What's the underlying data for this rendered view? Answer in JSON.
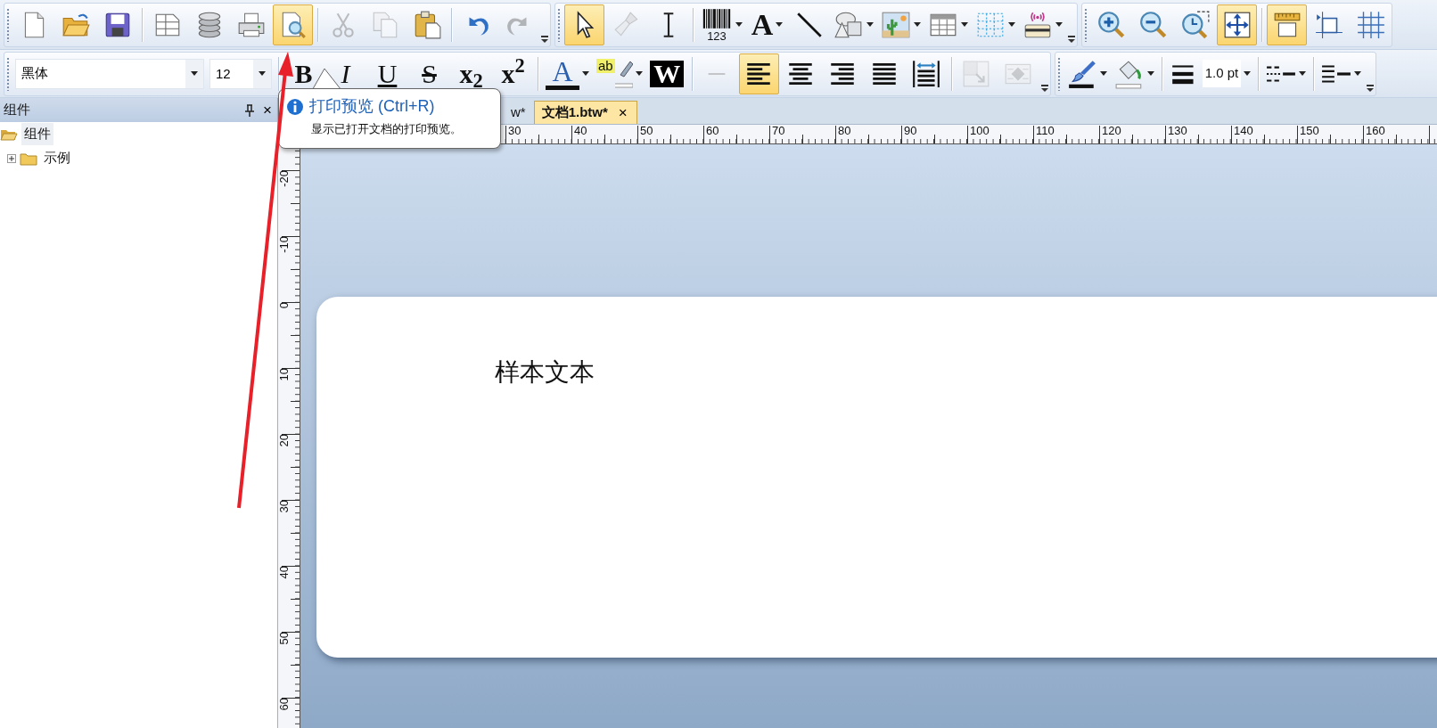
{
  "toolbars": [
    {
      "bands": [
        {
          "overflow": true,
          "items": [
            {
              "kind": "new",
              "selected": false,
              "disabled": false
            },
            {
              "kind": "open",
              "selected": false,
              "disabled": false
            },
            {
              "kind": "save",
              "selected": false,
              "disabled": false
            },
            {
              "kind": "separator"
            },
            {
              "kind": "layout",
              "selected": false,
              "disabled": false
            },
            {
              "kind": "database",
              "selected": false,
              "disabled": false
            },
            {
              "kind": "print",
              "selected": false,
              "disabled": false
            },
            {
              "kind": "preview",
              "selected": true,
              "disabled": false
            },
            {
              "kind": "separator"
            },
            {
              "kind": "cut",
              "selected": false,
              "disabled": true
            },
            {
              "kind": "copy",
              "selected": false,
              "disabled": true
            },
            {
              "kind": "paste",
              "selected": false,
              "disabled": false
            },
            {
              "kind": "separator"
            },
            {
              "kind": "undo",
              "selected": false,
              "disabled": false
            },
            {
              "kind": "redo",
              "selected": false,
              "disabled": true
            }
          ]
        },
        {
          "overflow": true,
          "items": [
            {
              "kind": "pointer",
              "selected": true,
              "disabled": false
            },
            {
              "kind": "brush",
              "selected": false,
              "disabled": true
            },
            {
              "kind": "ibeam",
              "selected": false,
              "disabled": false
            },
            {
              "kind": "separator"
            },
            {
              "kind": "barcode",
              "caption": "123",
              "selected": false,
              "disabled": false,
              "dropdown": true
            },
            {
              "kind": "text",
              "label": "A",
              "selected": false,
              "disabled": false,
              "dropdown": true
            },
            {
              "kind": "line",
              "selected": false,
              "disabled": false
            },
            {
              "kind": "shapes",
              "selected": false,
              "disabled": false,
              "dropdown": true
            },
            {
              "kind": "picture",
              "selected": false,
              "disabled": false,
              "dropdown": true
            },
            {
              "kind": "table",
              "selected": false,
              "disabled": false,
              "dropdown": true
            },
            {
              "kind": "grid",
              "selected": false,
              "disabled": false,
              "dropdown": true
            },
            {
              "kind": "rfid",
              "selected": false,
              "disabled": false,
              "dropdown": true
            }
          ]
        },
        {
          "overflow": false,
          "items": [
            {
              "kind": "zoomin",
              "selected": false,
              "disabled": false
            },
            {
              "kind": "zoomout",
              "selected": false,
              "disabled": false
            },
            {
              "kind": "zoompage",
              "selected": false,
              "disabled": false
            },
            {
              "kind": "fit",
              "selected": true,
              "disabled": false
            },
            {
              "kind": "separator"
            },
            {
              "kind": "ruler",
              "selected": true,
              "disabled": false
            },
            {
              "kind": "crop",
              "selected": false,
              "disabled": false
            },
            {
              "kind": "gridlines",
              "selected": false,
              "disabled": false
            }
          ]
        }
      ]
    },
    {
      "bands": [
        {
          "overflow": true,
          "items": [
            {
              "kind": "font-combo",
              "value": "黑体"
            },
            {
              "kind": "size-combo",
              "value": "12"
            },
            {
              "kind": "separator"
            },
            {
              "kind": "bold",
              "label": "B",
              "selected": false,
              "disabled": false
            },
            {
              "kind": "italic",
              "label": "I",
              "selected": false,
              "disabled": false
            },
            {
              "kind": "underline",
              "label": "U",
              "selected": false,
              "disabled": false
            },
            {
              "kind": "strike",
              "label": "S",
              "selected": false,
              "disabled": false
            },
            {
              "kind": "subscript",
              "label": "x$_{2}$",
              "selected": false,
              "disabled": false
            },
            {
              "kind": "superscript",
              "label": "x$^{2}$",
              "selected": false,
              "disabled": false
            },
            {
              "kind": "separator"
            },
            {
              "kind": "fontcolor",
              "label": "A",
              "selected": false,
              "disabled": false,
              "dropdown": true
            },
            {
              "kind": "highlight",
              "label": "ab",
              "selected": false,
              "disabled": false,
              "dropdown": true
            },
            {
              "kind": "inverse",
              "label": "W",
              "selected": false,
              "disabled": false
            },
            {
              "kind": "separator"
            },
            {
              "kind": "hline",
              "selected": false,
              "disabled": true
            },
            {
              "kind": "alignleft",
              "selected": true,
              "disabled": false
            },
            {
              "kind": "aligncenter",
              "selected": false,
              "disabled": false
            },
            {
              "kind": "alignright",
              "selected": false,
              "disabled": false
            },
            {
              "kind": "justify",
              "selected": false,
              "disabled": false
            },
            {
              "kind": "stretch",
              "selected": false,
              "disabled": false
            },
            {
              "kind": "separator"
            },
            {
              "kind": "front",
              "selected": false,
              "disabled": true
            },
            {
              "kind": "back",
              "selected": false,
              "disabled": true
            }
          ]
        },
        {
          "overflow": true,
          "items": [
            {
              "kind": "pen",
              "selected": false,
              "disabled": false,
              "dropdown": true
            },
            {
              "kind": "fill",
              "selected": false,
              "disabled": false,
              "dropdown": true
            },
            {
              "kind": "separator"
            },
            {
              "kind": "linewidth",
              "value": "1.0 pt",
              "selected": false,
              "disabled": false,
              "dropdown": true
            },
            {
              "kind": "separator"
            },
            {
              "kind": "dash",
              "selected": false,
              "disabled": false,
              "dropdown": true
            },
            {
              "kind": "separator"
            },
            {
              "kind": "linestyle",
              "selected": false,
              "disabled": false,
              "dropdown": true
            }
          ]
        }
      ]
    }
  ],
  "panel": {
    "title": "组件",
    "close": "×",
    "tree": [
      {
        "label": "组件",
        "selected": true,
        "expanded": true,
        "children": [
          {
            "label": "示例",
            "selected": false,
            "expanded": false
          }
        ]
      }
    ]
  },
  "tabs": [
    {
      "label": "w*",
      "selected": false
    },
    {
      "label": "文档1.btw*",
      "selected": true,
      "close": "×"
    }
  ],
  "horizontal_ruler": {
    "labels": [
      "30",
      "40",
      "50",
      "60",
      "70",
      "80",
      "90",
      "100",
      "110",
      "120",
      "130",
      "140",
      "150",
      "160"
    ]
  },
  "vertical_ruler": {
    "labels": [
      "-20",
      "-10",
      "0",
      "10",
      "20",
      "30",
      "40",
      "50",
      "60"
    ]
  },
  "label": {
    "text": "样本文本"
  },
  "tooltip": {
    "title": "打印预览 (Ctrl+R)",
    "description": "显示已打开文档的打印预览。"
  }
}
